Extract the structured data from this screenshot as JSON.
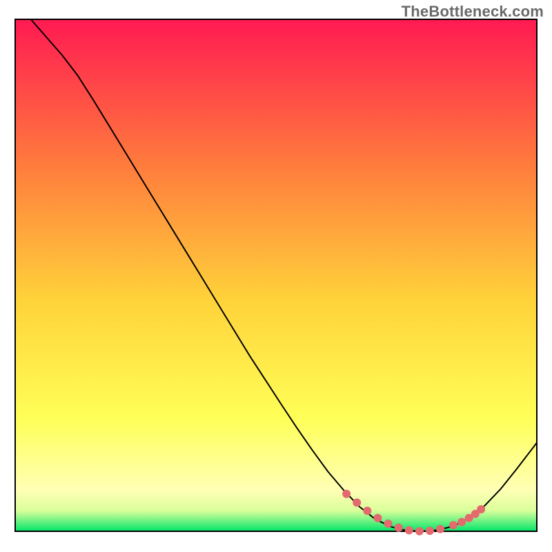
{
  "watermark": "TheBottleneck.com",
  "colors": {
    "gradient_top": "#ff1a52",
    "gradient_mid1": "#ff7a3d",
    "gradient_mid2": "#ffd33a",
    "gradient_mid3": "#ffff58",
    "gradient_bottom1": "#ffffb5",
    "gradient_bottom2": "#00e56a",
    "curve": "#000000",
    "marker": "#e46a6f"
  },
  "chart_data": {
    "type": "line",
    "title": "",
    "xlabel": "",
    "ylabel": "",
    "xlim": [
      0,
      100
    ],
    "ylim": [
      0,
      100
    ],
    "x": [
      3,
      6,
      9,
      12,
      15,
      18,
      21,
      24,
      27,
      30,
      33,
      36,
      39,
      42,
      45,
      48,
      51,
      54,
      57,
      60,
      63,
      66,
      69,
      72,
      75,
      78,
      81,
      84,
      87,
      90,
      93,
      96,
      100
    ],
    "values": [
      100,
      96.5,
      93,
      89,
      84.2,
      79.2,
      74.2,
      69.2,
      64.2,
      59.2,
      54.2,
      49.2,
      44.2,
      39.2,
      34.2,
      29.5,
      24.8,
      20.2,
      15.8,
      11.6,
      8.0,
      4.8,
      2.4,
      0.9,
      0.15,
      0.02,
      0.25,
      1.0,
      2.6,
      5.0,
      8.2,
      12.0,
      17.3
    ],
    "markers_x": [
      63.5,
      65.5,
      67.5,
      69.5,
      71.5,
      73.5,
      75.5,
      77.5,
      79.5,
      81.5,
      84.0,
      85.6,
      87.0,
      88.2,
      89.3
    ],
    "markers_y": [
      7.3,
      5.6,
      4.0,
      2.6,
      1.5,
      0.7,
      0.2,
      0.02,
      0.1,
      0.45,
      1.2,
      1.8,
      2.6,
      3.4,
      4.3
    ],
    "annotations": []
  }
}
